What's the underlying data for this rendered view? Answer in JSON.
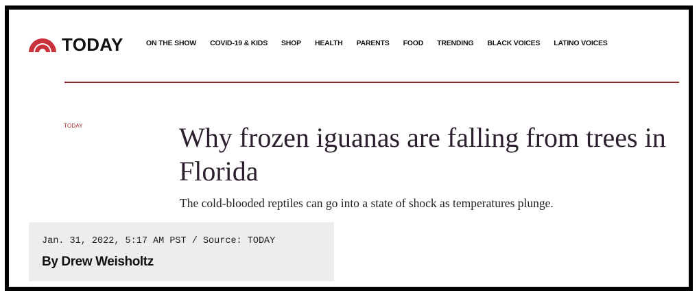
{
  "header": {
    "logo_text": "TODAY",
    "logo_icon": "sunrise-icon",
    "brand_color": "#c8313a",
    "nav_items": [
      "ON THE SHOW",
      "COVID-19 & KIDS",
      "SHOP",
      "HEALTH",
      "PARENTS",
      "FOOD",
      "TRENDING",
      "BLACK VOICES",
      "LATINO VOICES"
    ]
  },
  "article": {
    "kicker": "TODAY",
    "headline": "Why frozen iguanas are falling from trees in Florida",
    "dek": "The cold-blooded reptiles can go into a state of shock as temperatures plunge.",
    "dateline": "Jan. 31, 2022, 5:17 AM PST / Source: TODAY",
    "byline": "By Drew Weisholtz"
  },
  "colors": {
    "rule": "#8e2a2a",
    "kicker": "#a32424",
    "headline": "#2c1f2e"
  }
}
